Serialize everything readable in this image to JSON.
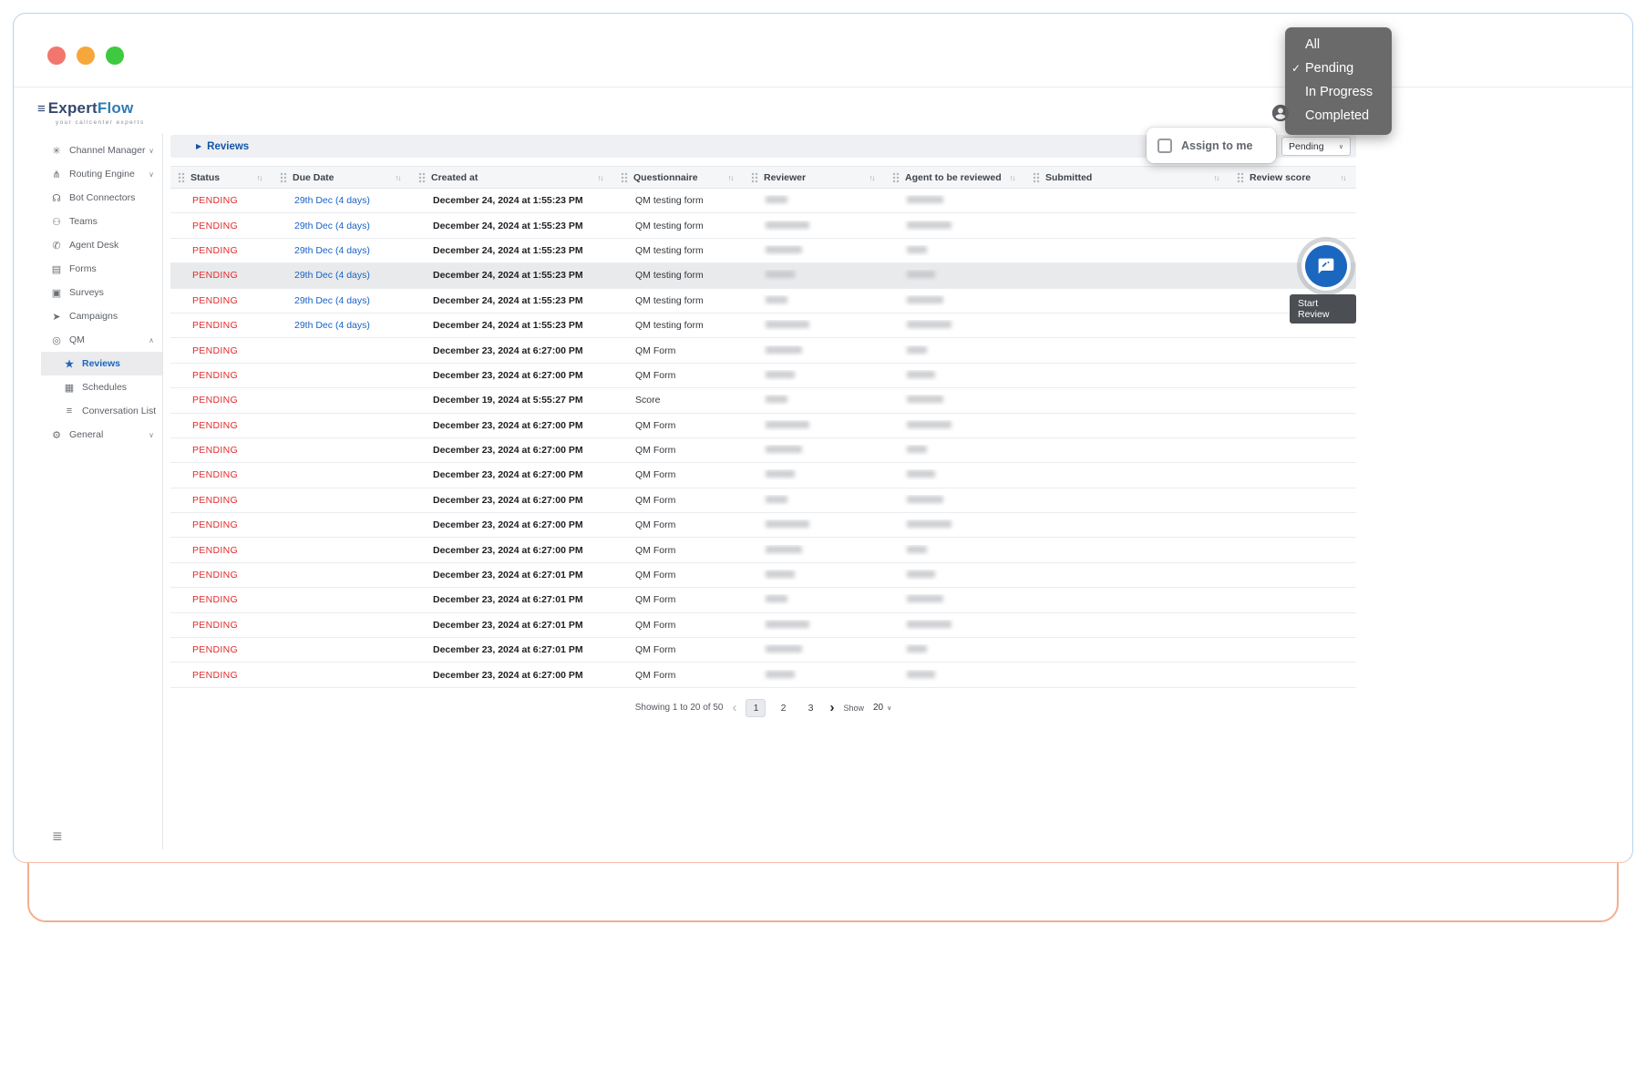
{
  "colors": {
    "accent_blue": "#1a66c2",
    "pending_red": "#e22b2b",
    "link_blue": "#1a62c6",
    "fab_blue": "#1b66bf",
    "highlight_orange": "#f3ae91",
    "frame_blue": "#b5d2ec"
  },
  "brand": {
    "name_primary": "Expert",
    "name_secondary": "Flow",
    "tagline": "your callcenter experts"
  },
  "icons": {
    "logo-icon": "≡",
    "channel-manager-icon": "✳",
    "routing-engine-icon": "⋔",
    "bot-connectors-icon": "☊",
    "teams-icon": "⚇",
    "agent-desk-icon": "✆",
    "forms-icon": "▤",
    "surveys-icon": "▣",
    "campaigns-icon": "➤",
    "qm-icon": "◎",
    "reviews-icon": "★",
    "schedules-icon": "▦",
    "conversation-list-icon": "≡",
    "general-icon": "⚙",
    "chevron-down": "∨",
    "chevron-up": "∧",
    "breadcrumb-arrow": "▶",
    "sort": "↑↓",
    "check": "✓",
    "prev": "‹",
    "next": "›",
    "sidebar-footer": "≣"
  },
  "sidebar": {
    "items": [
      {
        "id": "channel-manager",
        "label": "Channel Manager",
        "icon": "channel-manager-icon",
        "chevron": "down"
      },
      {
        "id": "routing-engine",
        "label": "Routing Engine",
        "icon": "routing-engine-icon",
        "chevron": "down"
      },
      {
        "id": "bot-connectors",
        "label": "Bot Connectors",
        "icon": "bot-connectors-icon"
      },
      {
        "id": "teams",
        "label": "Teams",
        "icon": "teams-icon"
      },
      {
        "id": "agent-desk",
        "label": "Agent Desk",
        "icon": "agent-desk-icon"
      },
      {
        "id": "forms",
        "label": "Forms",
        "icon": "forms-icon"
      },
      {
        "id": "surveys",
        "label": "Surveys",
        "icon": "surveys-icon"
      },
      {
        "id": "campaigns",
        "label": "Campaigns",
        "icon": "campaigns-icon"
      },
      {
        "id": "qm",
        "label": "QM",
        "icon": "qm-icon",
        "chevron": "up"
      },
      {
        "id": "reviews",
        "label": "Reviews",
        "icon": "reviews-icon",
        "child": true,
        "active": true
      },
      {
        "id": "schedules",
        "label": "Schedules",
        "icon": "schedules-icon",
        "child": true
      },
      {
        "id": "conversation-list",
        "label": "Conversation List",
        "icon": "conversation-list-icon",
        "child": true
      },
      {
        "id": "general",
        "label": "General",
        "icon": "general-icon",
        "chevron": "down"
      }
    ]
  },
  "breadcrumb": {
    "label": "Reviews"
  },
  "toolbar": {
    "assign_to_me_label": "Assign to me",
    "assign_to_me_checked": false,
    "status_filter_value": "Pending"
  },
  "status_dropdown": {
    "options": [
      {
        "label": "All",
        "checked": false
      },
      {
        "label": "Pending",
        "checked": true
      },
      {
        "label": "In Progress",
        "checked": false
      },
      {
        "label": "Completed",
        "checked": false
      }
    ]
  },
  "table": {
    "columns": [
      {
        "label": "Status",
        "sortable": true
      },
      {
        "label": "Due Date",
        "sortable": true
      },
      {
        "label": "Created at",
        "sortable": true
      },
      {
        "label": "Questionnaire",
        "sortable": true
      },
      {
        "label": "Reviewer",
        "sortable": true
      },
      {
        "label": "Agent to be reviewed",
        "sortable": true
      },
      {
        "label": "Submitted",
        "sortable": true
      },
      {
        "label": "Review score",
        "sortable": true
      }
    ],
    "rows": [
      {
        "status": "PENDING",
        "due": "29th Dec (4 days)",
        "created": "December 24, 2024 at 1:55:23 PM",
        "questionnaire": "QM testing form",
        "reviewer": "[redacted]",
        "agent": "[redacted]",
        "submitted": "",
        "score": ""
      },
      {
        "status": "PENDING",
        "due": "29th Dec (4 days)",
        "created": "December 24, 2024 at 1:55:23 PM",
        "questionnaire": "QM testing form",
        "reviewer": "[redacted]",
        "agent": "[redacted]",
        "submitted": "",
        "score": ""
      },
      {
        "status": "PENDING",
        "due": "29th Dec (4 days)",
        "created": "December 24, 2024 at 1:55:23 PM",
        "questionnaire": "QM testing form",
        "reviewer": "[redacted]",
        "agent": "[redacted]",
        "submitted": "",
        "score": ""
      },
      {
        "status": "PENDING",
        "due": "29th Dec (4 days)",
        "created": "December 24, 2024 at 1:55:23 PM",
        "questionnaire": "QM testing form",
        "reviewer": "[redacted]",
        "agent": "[redacted]",
        "submitted": "",
        "score": "",
        "highlighted": true
      },
      {
        "status": "PENDING",
        "due": "29th Dec (4 days)",
        "created": "December 24, 2024 at 1:55:23 PM",
        "questionnaire": "QM testing form",
        "reviewer": "[redacted]",
        "agent": "[redacted]",
        "submitted": "",
        "score": ""
      },
      {
        "status": "PENDING",
        "due": "29th Dec (4 days)",
        "created": "December 24, 2024 at 1:55:23 PM",
        "questionnaire": "QM testing form",
        "reviewer": "[redacted]",
        "agent": "[redacted]",
        "submitted": "",
        "score": ""
      },
      {
        "status": "PENDING",
        "due": "",
        "created": "December 23, 2024 at 6:27:00 PM",
        "questionnaire": "QM Form",
        "reviewer": "[redacted]",
        "agent": "[redacted]",
        "submitted": "",
        "score": ""
      },
      {
        "status": "PENDING",
        "due": "",
        "created": "December 23, 2024 at 6:27:00 PM",
        "questionnaire": "QM Form",
        "reviewer": "[redacted]",
        "agent": "[redacted]",
        "submitted": "",
        "score": ""
      },
      {
        "status": "PENDING",
        "due": "",
        "created": "December 19, 2024 at 5:55:27 PM",
        "questionnaire": "Score",
        "reviewer": "[redacted]",
        "agent": "[redacted]",
        "submitted": "",
        "score": ""
      },
      {
        "status": "PENDING",
        "due": "",
        "created": "December 23, 2024 at 6:27:00 PM",
        "questionnaire": "QM Form",
        "reviewer": "[redacted]",
        "agent": "[redacted]",
        "submitted": "",
        "score": ""
      },
      {
        "status": "PENDING",
        "due": "",
        "created": "December 23, 2024 at 6:27:00 PM",
        "questionnaire": "QM Form",
        "reviewer": "[redacted]",
        "agent": "[redacted]",
        "submitted": "",
        "score": ""
      },
      {
        "status": "PENDING",
        "due": "",
        "created": "December 23, 2024 at 6:27:00 PM",
        "questionnaire": "QM Form",
        "reviewer": "[redacted]",
        "agent": "[redacted]",
        "submitted": "",
        "score": ""
      },
      {
        "status": "PENDING",
        "due": "",
        "created": "December 23, 2024 at 6:27:00 PM",
        "questionnaire": "QM Form",
        "reviewer": "[redacted]",
        "agent": "[redacted]",
        "submitted": "",
        "score": ""
      },
      {
        "status": "PENDING",
        "due": "",
        "created": "December 23, 2024 at 6:27:00 PM",
        "questionnaire": "QM Form",
        "reviewer": "[redacted]",
        "agent": "[redacted]",
        "submitted": "",
        "score": ""
      },
      {
        "status": "PENDING",
        "due": "",
        "created": "December 23, 2024 at 6:27:00 PM",
        "questionnaire": "QM Form",
        "reviewer": "[redacted]",
        "agent": "[redacted]",
        "submitted": "",
        "score": ""
      },
      {
        "status": "PENDING",
        "due": "",
        "created": "December 23, 2024 at 6:27:01 PM",
        "questionnaire": "QM Form",
        "reviewer": "[redacted]",
        "agent": "[redacted]",
        "submitted": "",
        "score": ""
      },
      {
        "status": "PENDING",
        "due": "",
        "created": "December 23, 2024 at 6:27:01 PM",
        "questionnaire": "QM Form",
        "reviewer": "[redacted]",
        "agent": "[redacted]",
        "submitted": "",
        "score": ""
      },
      {
        "status": "PENDING",
        "due": "",
        "created": "December 23, 2024 at 6:27:01 PM",
        "questionnaire": "QM Form",
        "reviewer": "[redacted]",
        "agent": "[redacted]",
        "submitted": "",
        "score": ""
      },
      {
        "status": "PENDING",
        "due": "",
        "created": "December 23, 2024 at 6:27:01 PM",
        "questionnaire": "QM Form",
        "reviewer": "[redacted]",
        "agent": "[redacted]",
        "submitted": "",
        "score": ""
      },
      {
        "status": "PENDING",
        "due": "",
        "created": "December 23, 2024 at 6:27:00 PM",
        "questionnaire": "QM Form",
        "reviewer": "[redacted]",
        "agent": "[redacted]",
        "submitted": "",
        "score": ""
      }
    ]
  },
  "fab": {
    "tooltip": "Start Review"
  },
  "pagination": {
    "summary": "Showing 1 to 20 of 50",
    "pages": [
      "1",
      "2",
      "3"
    ],
    "active_page": "1",
    "show_label": "Show",
    "page_size": "20"
  }
}
